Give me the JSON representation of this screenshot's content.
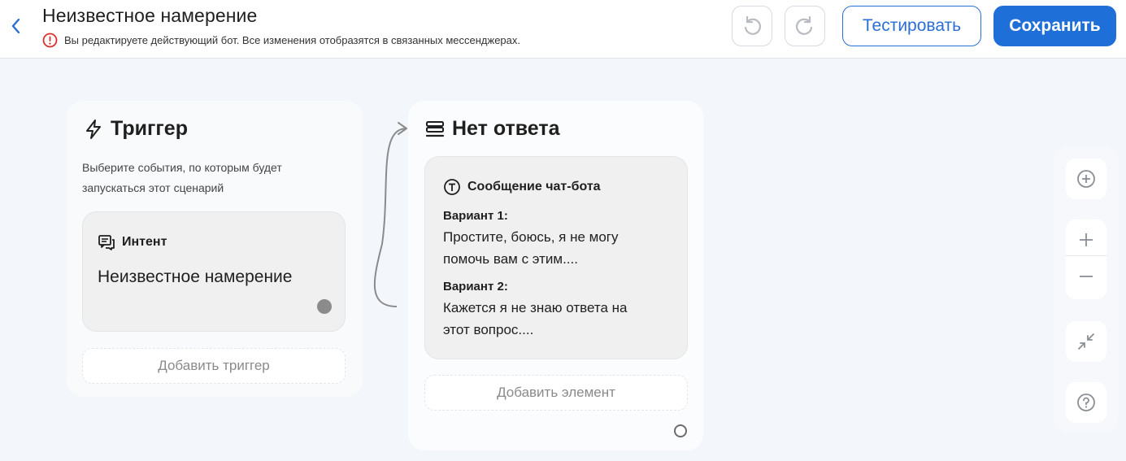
{
  "header": {
    "title": "Неизвестное намерение",
    "warning": "Вы редактируете действующий бот. Все изменения отобразятся в связанных мессенджерах.",
    "test_label": "Тестировать",
    "save_label": "Сохранить"
  },
  "trigger_card": {
    "title": "Триггер",
    "description": "Выберите события, по которым будет запускаться этот сценарий",
    "intent_label": "Интент",
    "intent_name": "Неизвестное намерение",
    "add_trigger_label": "Добавить триггер"
  },
  "answer_card": {
    "title": "Нет ответа",
    "message_label": "Сообщение чат-бота",
    "variants": [
      {
        "label": "Вариант 1:",
        "text": "Простите, боюсь, я не могу помочь вам с этим...."
      },
      {
        "label": "Вариант 2:",
        "text": "Кажется я не знаю ответа на этот вопрос...."
      }
    ],
    "add_element_label": "Добавить элемент"
  },
  "colors": {
    "accent": "#1f6fd8",
    "warning": "#d9302c",
    "background": "#f3f7fc"
  },
  "icons": [
    "back-chevron-icon",
    "warning-icon",
    "undo-icon",
    "redo-icon",
    "lightning-icon",
    "intent-icon",
    "list-icon",
    "text-t-icon",
    "add-circle-icon",
    "zoom-in-icon",
    "zoom-out-icon",
    "collapse-icon",
    "help-icon"
  ]
}
